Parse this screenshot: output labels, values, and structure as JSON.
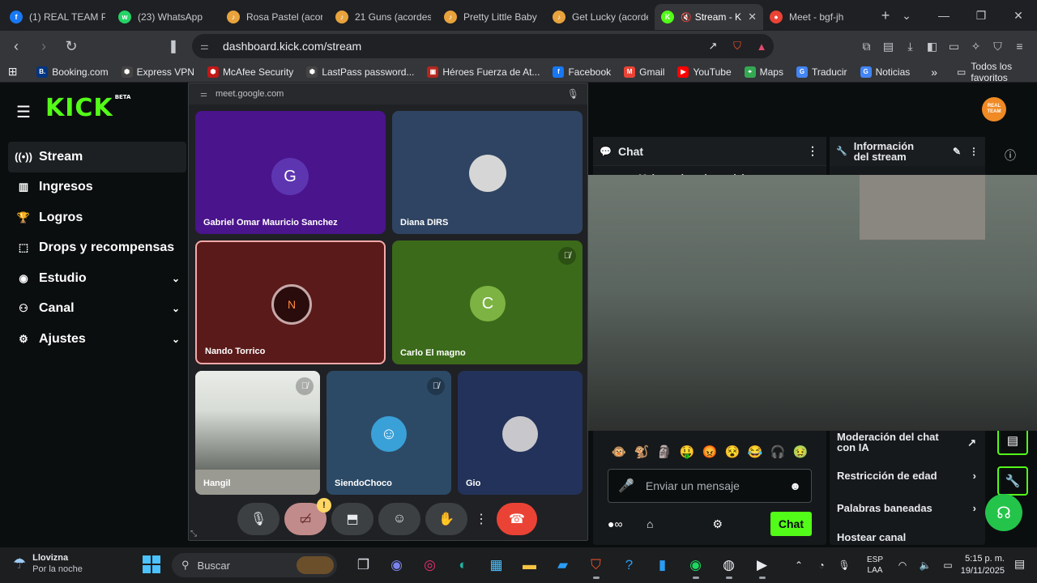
{
  "browser": {
    "tabs": [
      {
        "title": "(1) REAL TEAM PR",
        "fav_color": "#1877f2",
        "fav_glyph": "f"
      },
      {
        "title": "(23) WhatsApp",
        "fav_color": "#25d366",
        "fav_glyph": "w"
      },
      {
        "title": "Rosa Pastel (acorc",
        "fav_color": "#e8a33d",
        "fav_glyph": "♪"
      },
      {
        "title": "21 Guns (acordes",
        "fav_color": "#e8a33d",
        "fav_glyph": "♪"
      },
      {
        "title": "Pretty Little Baby",
        "fav_color": "#e8a33d",
        "fav_glyph": "♪"
      },
      {
        "title": "Get Lucky (acorde",
        "fav_color": "#e8a33d",
        "fav_glyph": "♪"
      },
      {
        "title": "Stream - K",
        "fav_color": "#53fc18",
        "fav_glyph": "K",
        "active": true
      },
      {
        "title": "Meet - bgf-jh",
        "fav_color": "#ea4335",
        "fav_glyph": "●"
      }
    ],
    "new_tab_label": "+",
    "address": "dashboard.kick.com/stream",
    "bookmarks": [
      {
        "label": "Booking.com",
        "color": "#003580",
        "glyph": "B."
      },
      {
        "label": "Express VPN",
        "color": "#444",
        "glyph": "⬢"
      },
      {
        "label": "McAfee Security",
        "color": "#c01818",
        "glyph": "⬢"
      },
      {
        "label": "LastPass password...",
        "color": "#444",
        "glyph": "⬢"
      },
      {
        "label": "Héroes Fuerza de At...",
        "color": "#b3261e",
        "glyph": "▣"
      },
      {
        "label": "Facebook",
        "color": "#1877f2",
        "glyph": "f"
      },
      {
        "label": "Gmail",
        "color": "#ea4335",
        "glyph": "M"
      },
      {
        "label": "YouTube",
        "color": "#ff0000",
        "glyph": "▶"
      },
      {
        "label": "Maps",
        "color": "#34a853",
        "glyph": "⌖"
      },
      {
        "label": "Traducir",
        "color": "#4285f4",
        "glyph": "G"
      },
      {
        "label": "Noticias",
        "color": "#4285f4",
        "glyph": "G"
      }
    ],
    "bookmarks_more": "»",
    "all_bookmarks": "Todos los favoritos"
  },
  "kick": {
    "logo": "KICK",
    "logo_badge": "BETA",
    "avatar_text": "REAL TEAM",
    "sidebar": [
      {
        "label": "Stream",
        "icon": "((•))",
        "active": true,
        "chevron": ""
      },
      {
        "label": "Ingresos",
        "icon": "▥",
        "chevron": ""
      },
      {
        "label": "Logros",
        "icon": "🏆",
        "chevron": ""
      },
      {
        "label": "Drops y recompensas",
        "icon": "⬚",
        "chevron": ""
      },
      {
        "label": "Estudio",
        "icon": "◉",
        "chevron": "⌄"
      },
      {
        "label": "Canal",
        "icon": "⚇",
        "chevron": "⌄"
      },
      {
        "label": "Ajustes",
        "icon": "⚙",
        "chevron": "⌄"
      }
    ],
    "chat": {
      "title": "Chat",
      "subtitle": "Mejores donadores del mes",
      "input_placeholder": "Enviar un mensaje",
      "send_label": "Chat",
      "emotes": [
        "🐵",
        "🐒",
        "🗿",
        "🤑",
        "😡",
        "😵",
        "😂",
        "🎧",
        "🤢"
      ]
    },
    "stream_info": {
      "title_line1": "Información",
      "title_line2": "del stream",
      "settings": [
        {
          "label": "Moderación del chat con IA",
          "action": "↗"
        },
        {
          "label": "Restricción de edad",
          "action": "›"
        },
        {
          "label": "Palabras baneadas",
          "action": "›"
        },
        {
          "label": "Hostear canal",
          "action": ""
        }
      ]
    }
  },
  "meet": {
    "url": "meet.google.com",
    "participants": [
      {
        "name": "Gabriel Omar Mauricio Sanchez",
        "initial": "G"
      },
      {
        "name": "Diana DIRS",
        "initial": ""
      },
      {
        "name": "Nando Torrico",
        "initial": "N"
      },
      {
        "name": "Carlo El magno",
        "initial": "C"
      },
      {
        "name": "Hangil",
        "initial": ""
      },
      {
        "name": "SiendoChoco",
        "initial": ""
      },
      {
        "name": "Gio",
        "initial": ""
      }
    ],
    "warning_badge": "!"
  },
  "taskbar": {
    "weather_title": "Llovizna",
    "weather_sub": "Por la noche",
    "search_placeholder": "Buscar",
    "lang_line1": "ESP",
    "lang_line2": "LAA",
    "time": "5:15 p. m.",
    "date": "19/11/2025"
  }
}
